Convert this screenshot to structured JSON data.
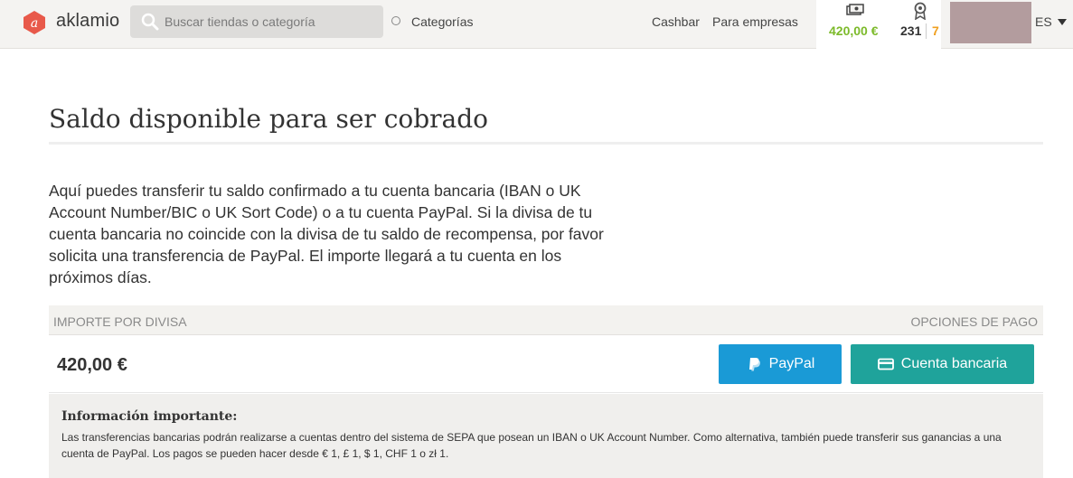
{
  "header": {
    "logo_text": "aklamio",
    "search": {
      "placeholder": "Buscar tiendas o categoría"
    },
    "categories_label": "Categorías",
    "nav": {
      "cashbar": "Cashbar",
      "empresas": "Para empresas"
    },
    "stats": {
      "balance": "420,00 €",
      "points": "231",
      "level": "7"
    },
    "language": "ES",
    "colors": {
      "balance": "#7cba2a",
      "level": "#f0a020",
      "logo": "#e8594a"
    }
  },
  "main": {
    "title": "Saldo disponible para ser cobrado",
    "intro": "Aquí puedes transferir tu saldo confirmado a tu cuenta bancaria (IBAN o UK Account Number/BIC o UK Sort Code) o a tu cuenta PayPal. Si la divisa de tu cuenta bancaria no coincide con la divisa de tu saldo de recompensa, por favor solicita una transferencia de PayPal. El importe llegará a tu cuenta en los próximos días.",
    "table": {
      "header_left": "IMPORTE POR DIVISA",
      "header_right": "OPCIONES DE PAGO",
      "amount": "420,00 €",
      "paypal_label": "PayPal",
      "bank_label": "Cuenta bancaria"
    },
    "info": {
      "title": "Información importante:",
      "text": "Las transferencias bancarias podrán realizarse a cuentas dentro del sistema de SEPA que posean un IBAN o UK Account Number. Como alternativa, también puede transferir sus ganancias a una cuenta de PayPal. Los pagos se pueden hacer desde € 1, £ 1, $ 1, CHF 1 o zł 1."
    },
    "colors": {
      "paypal": "#1a9ad6",
      "bank": "#1fa39b"
    }
  }
}
